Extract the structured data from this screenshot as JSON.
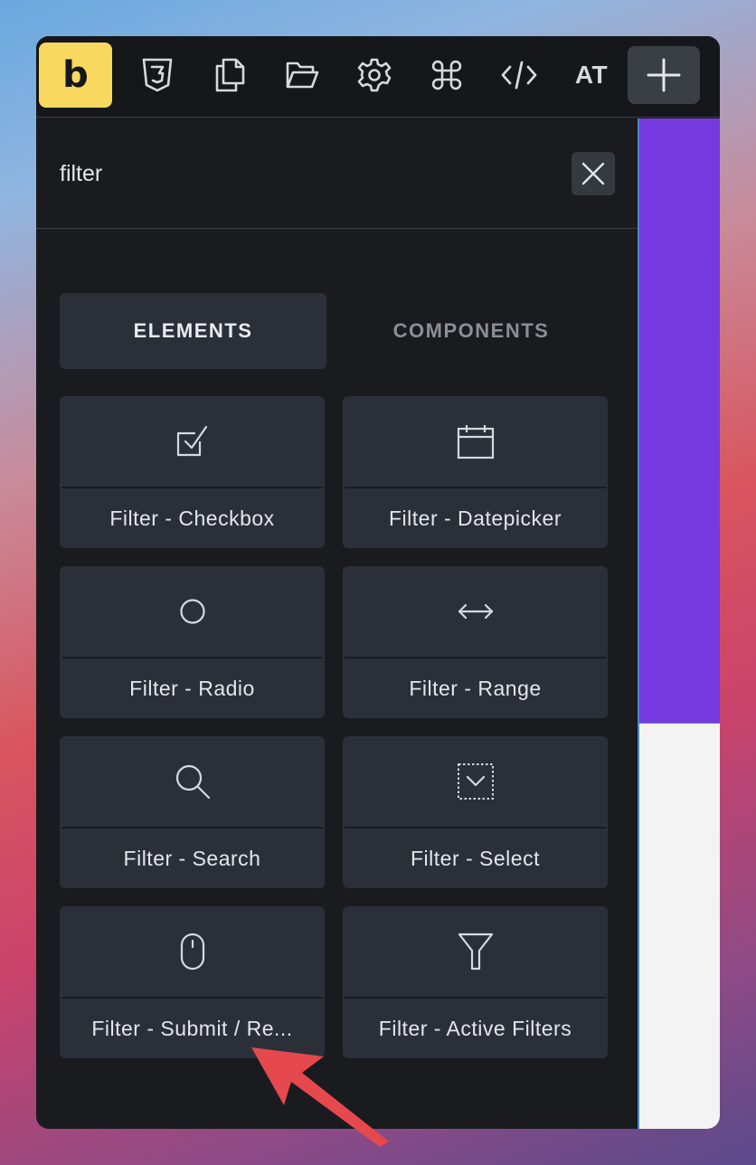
{
  "toolbar": {
    "logo_text": "b",
    "icons": [
      "css3-icon",
      "copy-pages-icon",
      "folder-open-icon",
      "gear-icon",
      "command-icon",
      "code-icon",
      "at-icon",
      "plus-icon"
    ],
    "at_label": "AT"
  },
  "search": {
    "value": "filter",
    "placeholder": ""
  },
  "tabs": [
    {
      "label": "ELEMENTS",
      "active": true
    },
    {
      "label": "COMPONENTS",
      "active": false
    }
  ],
  "elements": [
    {
      "label": "Filter - Checkbox",
      "icon": "checkbox-icon"
    },
    {
      "label": "Filter - Datepicker",
      "icon": "calendar-icon"
    },
    {
      "label": "Filter - Radio",
      "icon": "radio-circle-icon"
    },
    {
      "label": "Filter - Range",
      "icon": "horizontal-arrows-icon"
    },
    {
      "label": "Filter - Search",
      "icon": "search-icon"
    },
    {
      "label": "Filter - Select",
      "icon": "select-dropdown-icon"
    },
    {
      "label": "Filter - Submit / Re...",
      "icon": "mouse-icon"
    },
    {
      "label": "Filter - Active Filters",
      "icon": "funnel-icon"
    }
  ],
  "colors": {
    "logo_bg": "#f8d85e",
    "panel_bg": "#191b1f",
    "card_bg": "#2b3038",
    "canvas_purple": "#7639e0",
    "annotation_arrow": "#e5484d"
  }
}
